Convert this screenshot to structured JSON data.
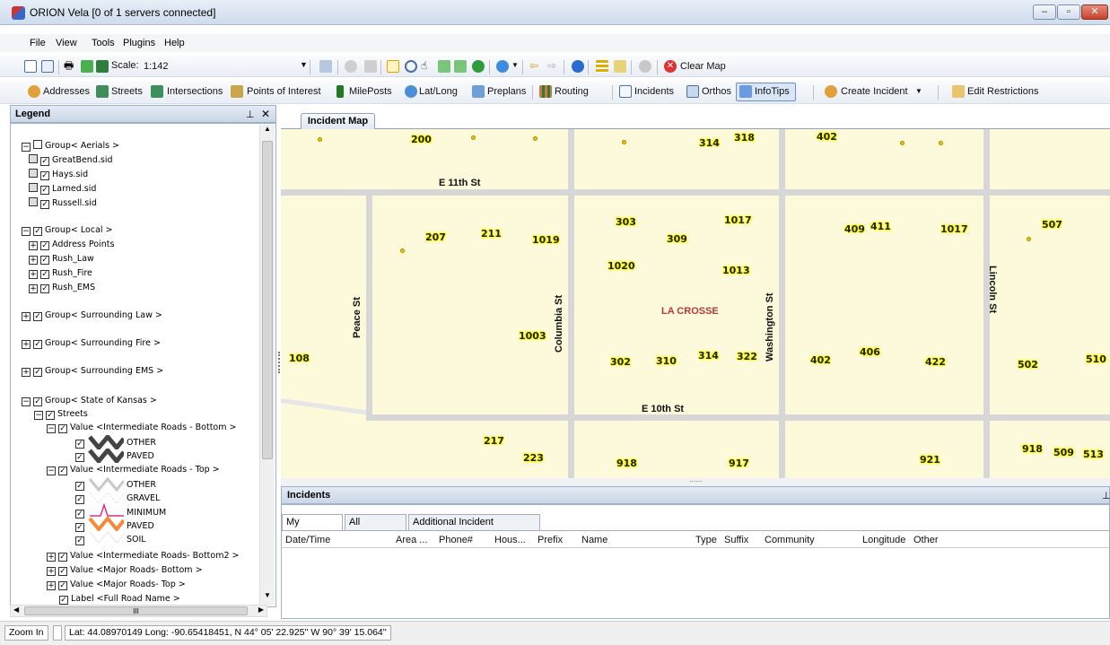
{
  "window": {
    "title": "ORION Vela  [0 of 1 servers connected]",
    "min": "–",
    "max": "▫",
    "close": "✕"
  },
  "menu": [
    "File",
    "View",
    "Tools",
    "Plugins",
    "Help"
  ],
  "toolbar1": {
    "scale_label": "Scale:",
    "scale_value": "1:142",
    "clear_map": "Clear Map"
  },
  "toolbar2": [
    "Addresses",
    "Streets",
    "Intersections",
    "Points of Interest",
    "MilePosts",
    "Lat/Long",
    "Preplans",
    "Routing",
    "Incidents",
    "Orthos",
    "InfoTips",
    "Create Incident",
    "Edit Restrictions"
  ],
  "legend": {
    "title": "Legend",
    "pin": "⊥",
    "close": "✕",
    "rows": [
      "Group< Aerials >",
      "GreatBend.sid",
      "Hays.sid",
      "Larned.sid",
      "Russell.sid",
      "Group< Local >",
      "Address Points",
      "Rush_Law",
      "Rush_Fire",
      "Rush_EMS",
      "Group< Surrounding Law >",
      "Group< Surrounding Fire >",
      "Group< Surrounding EMS >",
      "Group< State of Kansas >",
      "Streets",
      "Value <Intermediate Roads - Bottom >",
      "OTHER",
      "PAVED",
      "Value <Intermediate Roads - Top >",
      "OTHER",
      "GRAVEL",
      "MINIMUM",
      "PAVED",
      "SOIL",
      "Value <Intermediate Roads- Bottom2 >",
      "Value <Major Roads- Bottom >",
      "Value <Major Roads- Top >",
      "Label <Full Road Name >"
    ],
    "scroll_marker": "III"
  },
  "map": {
    "tab": "Incident Map",
    "city": "LA CROSSE",
    "streets": {
      "e11": "E 11th St",
      "e10": "E 10th St",
      "peace": "Peace St",
      "columbia": "Columbia St",
      "washington": "Washington St",
      "lincoln": "Lincoln St"
    },
    "addresses": [
      "200",
      "314",
      "318",
      "402",
      "303",
      "1017",
      "409",
      "411",
      "1017",
      "507",
      "207",
      "211",
      "1019",
      "309",
      "1020",
      "1013",
      "1003",
      "108",
      "302",
      "310",
      "314",
      "322",
      "402",
      "406",
      "422",
      "502",
      "510",
      "217",
      "223",
      "918",
      "917",
      "921",
      "918",
      "509",
      "513"
    ],
    "splitter": "......"
  },
  "incidents": {
    "title": "Incidents",
    "pin": "⊥",
    "tabs": [
      "My Incidents",
      "All Incidents",
      "Additional Incident Information"
    ],
    "columns": [
      "Date/Time",
      "Area ...",
      "Phone#",
      "Hous...",
      "Prefix",
      "Name",
      "Type",
      "Suffix",
      "Community",
      "Longitude",
      "Other"
    ]
  },
  "status": {
    "zoom": "Zoom In",
    "coords": "Lat: 44.08970149 Long: -90.65418451,  N 44° 05' 22.925'' W 90° 39' 15.064''"
  }
}
